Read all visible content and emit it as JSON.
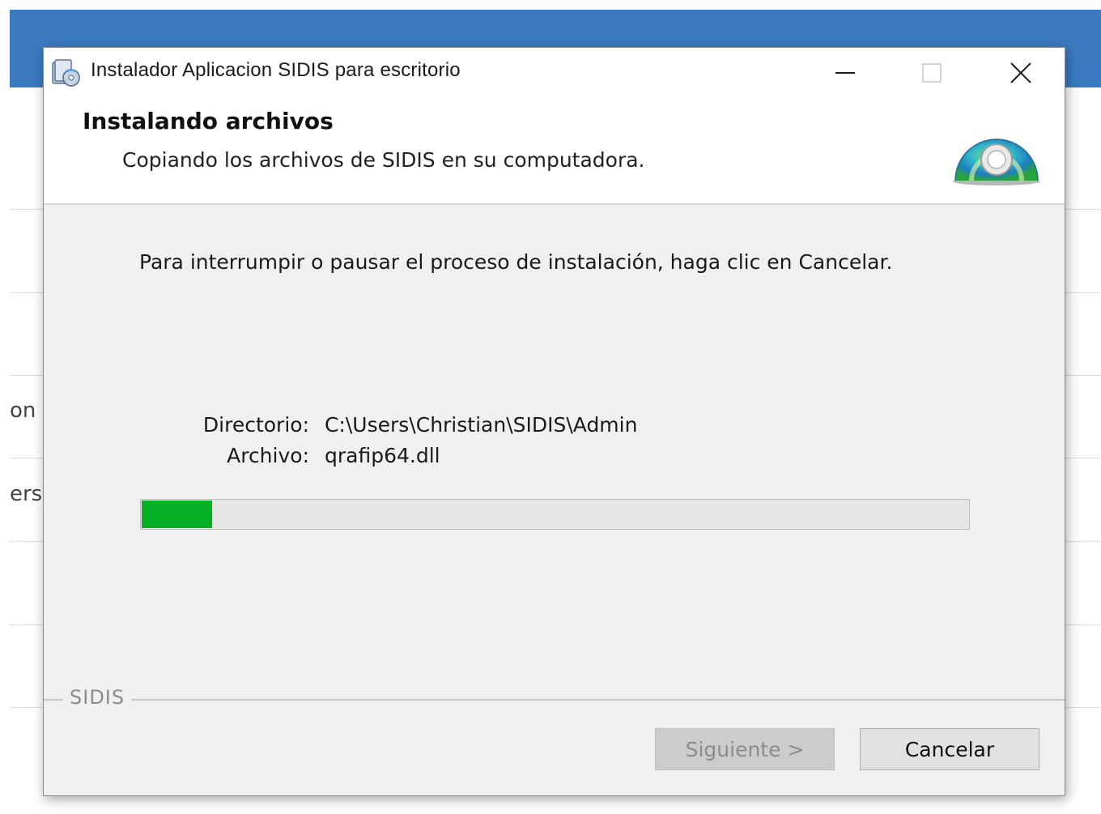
{
  "background_app": {
    "header_color": "#3b7ac0",
    "partial_labels": [
      "on",
      "ers"
    ]
  },
  "window": {
    "title": "Instalador Aplicacion SIDIS para escritorio",
    "icons": {
      "app": "installer-icon",
      "minimize": "minimize-icon",
      "maximize": "maximize-icon",
      "close": "close-icon"
    }
  },
  "header": {
    "title": "Instalando archivos",
    "subtitle": "Copiando los archivos de SIDIS en su computadora.",
    "icon": "cd-disc-icon"
  },
  "body": {
    "instruction": "Para interrumpir o pausar el proceso de instalación, haga clic en Cancelar.",
    "directory_label": "Directorio:",
    "directory_value": "C:\\Users\\Christian\\SIDIS\\Admin",
    "file_label": "Archivo:",
    "file_value": "qrafip64.dll"
  },
  "progress": {
    "fraction": 0.085,
    "fill_color": "#06b025"
  },
  "branding": {
    "text": "SIDIS"
  },
  "buttons": {
    "next_label": "Siguiente >",
    "next_enabled": false,
    "cancel_label": "Cancelar"
  }
}
